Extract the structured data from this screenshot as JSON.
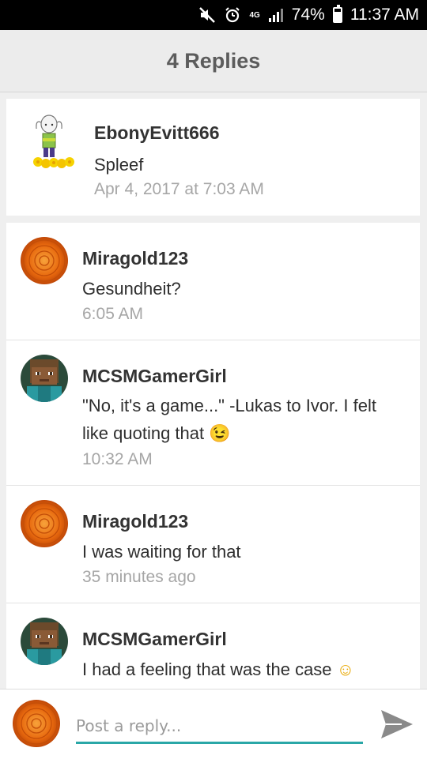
{
  "status_bar": {
    "network": "4G",
    "battery": "74%",
    "time": "11:37 AM"
  },
  "header": {
    "title": "4 Replies"
  },
  "original_post": {
    "author": "EbonyEvitt666",
    "message": "Spleef",
    "timestamp": "Apr 4, 2017 at 7:03 AM"
  },
  "replies": [
    {
      "author": "Miragold123",
      "message": "Gesundheit?",
      "timestamp": "6:05 AM"
    },
    {
      "author": "MCSMGamerGirl",
      "message": "\"No, it's a game...\" -Lukas to Ivor. I felt like quoting that",
      "emoji": "😉",
      "timestamp": "10:32 AM"
    },
    {
      "author": "Miragold123",
      "message": "I was waiting for that",
      "timestamp": "35 minutes ago"
    },
    {
      "author": "MCSMGamerGirl",
      "message": "I had a feeling that was the case",
      "emoji": "☺",
      "timestamp": ""
    }
  ],
  "reply_bar": {
    "placeholder": "Post a reply..."
  },
  "colors": {
    "accent": "#2aa7a7",
    "background": "#efefef",
    "marigold": "#e8690e"
  }
}
